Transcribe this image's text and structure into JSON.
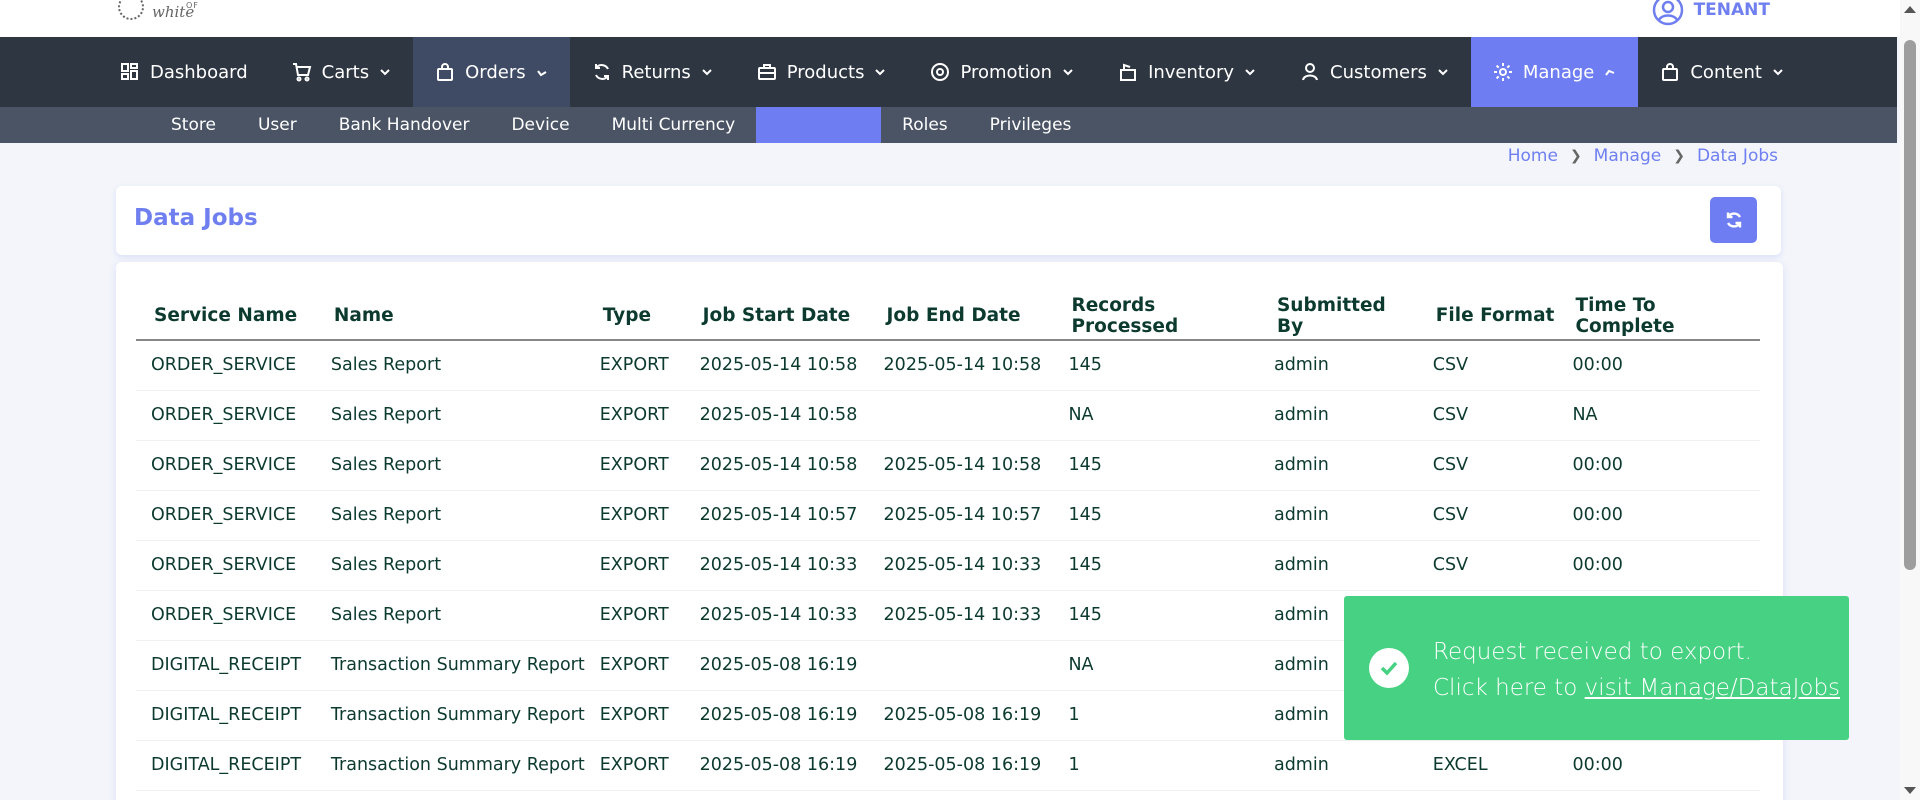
{
  "brand": {
    "logo_text": "white",
    "logo_sub": "SHADOW OF"
  },
  "user": {
    "label": "TENANT"
  },
  "nav": [
    {
      "label": "Dashboard",
      "icon": "grid-icon"
    },
    {
      "label": "Carts",
      "icon": "cart-icon"
    },
    {
      "label": "Orders",
      "icon": "bag-icon"
    },
    {
      "label": "Returns",
      "icon": "refresh-icon"
    },
    {
      "label": "Products",
      "icon": "briefcase-icon"
    },
    {
      "label": "Promotion",
      "icon": "badge-icon"
    },
    {
      "label": "Inventory",
      "icon": "box-icon"
    },
    {
      "label": "Customers",
      "icon": "user-icon"
    },
    {
      "label": "Manage",
      "icon": "gear-icon"
    },
    {
      "label": "Content",
      "icon": "bag-icon"
    }
  ],
  "subnav": [
    {
      "label": "Store"
    },
    {
      "label": "User"
    },
    {
      "label": "Bank Handover"
    },
    {
      "label": "Device"
    },
    {
      "label": "Multi Currency"
    },
    {
      "label": ""
    },
    {
      "label": "Roles"
    },
    {
      "label": "Privileges"
    }
  ],
  "breadcrumb": [
    "Home",
    "Manage",
    "Data Jobs"
  ],
  "page": {
    "title": "Data Jobs"
  },
  "table": {
    "headers": [
      "Service Name",
      "Name",
      "Type",
      "Job Start Date",
      "Job End Date",
      "Records Processed",
      "Submitted By",
      "File Format",
      "Time To Complete"
    ],
    "rows": [
      [
        "ORDER_SERVICE",
        "Sales Report",
        "EXPORT",
        "2025-05-14 10:58",
        "2025-05-14 10:58",
        "145",
        "admin",
        "CSV",
        "00:00"
      ],
      [
        "ORDER_SERVICE",
        "Sales Report",
        "EXPORT",
        "2025-05-14 10:58",
        "",
        "NA",
        "admin",
        "CSV",
        "NA"
      ],
      [
        "ORDER_SERVICE",
        "Sales Report",
        "EXPORT",
        "2025-05-14 10:58",
        "2025-05-14 10:58",
        "145",
        "admin",
        "CSV",
        "00:00"
      ],
      [
        "ORDER_SERVICE",
        "Sales Report",
        "EXPORT",
        "2025-05-14 10:57",
        "2025-05-14 10:57",
        "145",
        "admin",
        "CSV",
        "00:00"
      ],
      [
        "ORDER_SERVICE",
        "Sales Report",
        "EXPORT",
        "2025-05-14 10:33",
        "2025-05-14 10:33",
        "145",
        "admin",
        "CSV",
        "00:00"
      ],
      [
        "ORDER_SERVICE",
        "Sales Report",
        "EXPORT",
        "2025-05-14 10:33",
        "2025-05-14 10:33",
        "145",
        "admin",
        "",
        ""
      ],
      [
        "DIGITAL_RECEIPT",
        "Transaction Summary Report",
        "EXPORT",
        "2025-05-08 16:19",
        "",
        "NA",
        "admin",
        "",
        ""
      ],
      [
        "DIGITAL_RECEIPT",
        "Transaction Summary Report",
        "EXPORT",
        "2025-05-08 16:19",
        "2025-05-08 16:19",
        "1",
        "admin",
        "",
        ""
      ],
      [
        "DIGITAL_RECEIPT",
        "Transaction Summary Report",
        "EXPORT",
        "2025-05-08 16:19",
        "2025-05-08 16:19",
        "1",
        "admin",
        "EXCEL",
        "00:00"
      ]
    ]
  },
  "toast": {
    "line1": "Request received to export.",
    "line2_prefix": "Click here to ",
    "link": "visit Manage/DataJobs"
  },
  "colors": {
    "accent": "#6e7ef2",
    "nav_bg": "#2e3642",
    "subnav_bg": "#4a5465",
    "toast": "#47d182"
  }
}
